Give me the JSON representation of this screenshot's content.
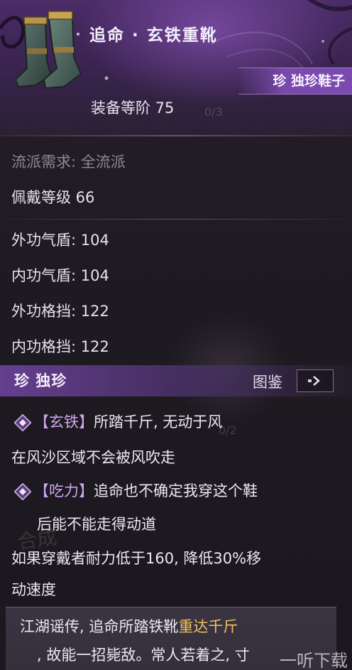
{
  "header": {
    "item_name": "追命 · 玄铁重靴",
    "rarity_tag": "珍 独珍鞋子",
    "equip_tier": "装备等阶 75",
    "ghost_text": "0/3"
  },
  "requirements": {
    "school": "流派需求: 全流派",
    "wear_level": "佩戴等级 66"
  },
  "stats": [
    {
      "label": "外功气盾: ",
      "value": "104"
    },
    {
      "label": "内功气盾: ",
      "value": "104"
    },
    {
      "label": "外功格挡: ",
      "value": "122"
    },
    {
      "label": "内功格挡: ",
      "value": "122"
    }
  ],
  "rarity_section": {
    "title": "珍  独珍",
    "atlas_label": "图鉴",
    "ghost_text": "0/2"
  },
  "skills": [
    {
      "open": "【",
      "name": "玄铁",
      "close": "】",
      "text": "所踏千斤, 无动于风",
      "desc": [
        "在风沙区域不会被风吹走"
      ]
    },
    {
      "open": "【",
      "name": "吃力",
      "close": "】",
      "text": "追命也不确定我穿这个鞋",
      "desc": [
        "后能不能走得动道"
      ]
    }
  ],
  "effect_lines": [
    "如果穿戴者耐力低于160, 降低30%移",
    "动速度"
  ],
  "merge_mark": "合成",
  "lore": {
    "line1_a": "江湖谣传, 追命所踏铁靴",
    "line1_hl": "重达千斤",
    "line2": ", 故能一招毙敌。常人若着之, 寸"
  },
  "watermark": "一听下载",
  "colors": {
    "header_purple": "#4a2c67",
    "highlight_gold": "#f2c35a",
    "bracket_purple": "#cfa5f0"
  }
}
